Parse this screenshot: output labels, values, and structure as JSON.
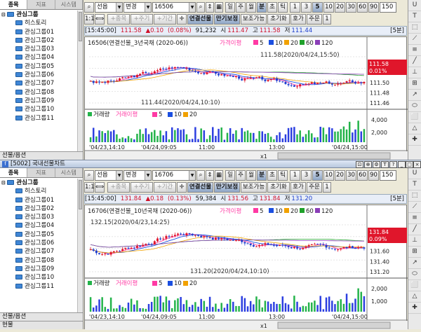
{
  "window2_title": "[5002] 국내선물차트",
  "sidebar": {
    "tabs": [
      "종목",
      "지표",
      "시스템"
    ],
    "root": "관심그룹",
    "items": [
      "히스토리",
      "관심그룹01",
      "관심그룹02",
      "관심그룹03",
      "관심그룹04",
      "관심그룹05",
      "관심그룹06",
      "관심그룹07",
      "관심그룹08",
      "관심그룹09",
      "관심그룹10",
      "관심그룹11"
    ],
    "footer": "선물/옵션"
  },
  "toolbar": {
    "market": "선옵",
    "change": "변경",
    "periods": [
      "일",
      "주",
      "월",
      "분",
      "초",
      "틱"
    ],
    "active_period": "분",
    "intervals": [
      "1",
      "3",
      "5",
      "10",
      "20",
      "30",
      "60",
      "90"
    ],
    "active_interval": "5",
    "range": "150",
    "toggle": "∨"
  },
  "toolbar2": {
    "lbl1": "1:1",
    "lbl2": "종목",
    "lbl3": "주기",
    "lbl4": "기간",
    "link": "연결선물",
    "expiry": "만기보정",
    "assist": "보조가능",
    "reset": "초기화",
    "quote": "호가",
    "order": "주문",
    "stay": "1"
  },
  "right_icons": [
    "U",
    "T",
    "⬚",
    "⟋",
    "≡",
    "╱",
    "⊥",
    "⊞",
    "↗",
    "⬭",
    "⬜",
    "△",
    "✚",
    "❖",
    "⤡",
    "⬍",
    "⬇",
    "⬆",
    "⬈",
    "▭",
    "⌇",
    "⋯",
    "∥",
    "≡",
    "⟋",
    "⟋"
  ],
  "charts": [
    {
      "code": "16506",
      "time": "[15:45:00]",
      "price": "111.58",
      "change": "▲0.10",
      "pct": "(0.08%)",
      "volume": "91,232",
      "open_lbl": "시",
      "open": "111.47",
      "high_lbl": "고",
      "high": "111.58",
      "low_lbl": "저",
      "low": "111.44",
      "interval_lbl": "[5분]",
      "legend": {
        "name": "16506(연결선물_3년국채 (2020-06))",
        "ma_title": "가격이평",
        "mas": [
          "5",
          "10",
          "20",
          "60",
          "120"
        ]
      },
      "hi_label": "111.58(2020/04/24,15:50)",
      "lo_label": "111.44(2020/04/24,10:10)",
      "last_price": "111.58",
      "last_pct": "0.01%",
      "y_ticks": [
        "111.54",
        "111.52",
        "111.50",
        "111.48",
        "111.46"
      ],
      "vol_legend": {
        "a": "거래량",
        "b": "거래이평",
        "mas": [
          "5",
          "10",
          "20"
        ]
      },
      "vol_ticks": [
        "4,000",
        "2,000"
      ],
      "x_ticks": [
        "'04/23,14:10",
        "'04/24,09:05",
        "11:00",
        "13:00",
        "'04/24,15:00"
      ],
      "zoom": "x1"
    },
    {
      "code": "16706",
      "time": "[15:45:00]",
      "price": "131.84",
      "change": "▲0.18",
      "pct": "(0.13%)",
      "volume": "59,384",
      "open_lbl": "시",
      "open": "131.56",
      "high_lbl": "고",
      "high": "131.84",
      "low_lbl": "저",
      "low": "131.20",
      "interval_lbl": "[5분]",
      "legend": {
        "name": "16706(연결선물_10년국채 (2020-06))",
        "ma_title": "가격이평",
        "mas": [
          "5",
          "10",
          "20",
          "60",
          "120"
        ]
      },
      "hi_label": "132.15(2020/04/23,14:25)",
      "lo_label": "131.20(2020/04/24,10:10)",
      "last_price": "131.84",
      "last_pct": "0.09%",
      "y_ticks": [
        "132.00",
        "131.80",
        "131.60",
        "131.40",
        "131.20"
      ],
      "vol_legend": {
        "a": "거래량",
        "b": "거래이평",
        "mas": [
          "5",
          "10",
          "20"
        ]
      },
      "vol_ticks": [
        "2,000",
        "1,000"
      ],
      "x_ticks": [
        "'04/23,14:10",
        "'04/24,09:05",
        "11:00",
        "13:00",
        "'04/24,15:00"
      ],
      "zoom": "x1"
    }
  ],
  "bottom_footer": "현물",
  "colors": {
    "up": "#e0162b",
    "down": "#1f3fd0",
    "ma5": "#ff3aa4",
    "ma10": "#1b4fe0",
    "ma20": "#f1a100",
    "ma60": "#1fa12a",
    "ma120": "#8b3fb8",
    "vol_up": "#23b34a",
    "vol_dn": "#2c3fe0"
  }
}
